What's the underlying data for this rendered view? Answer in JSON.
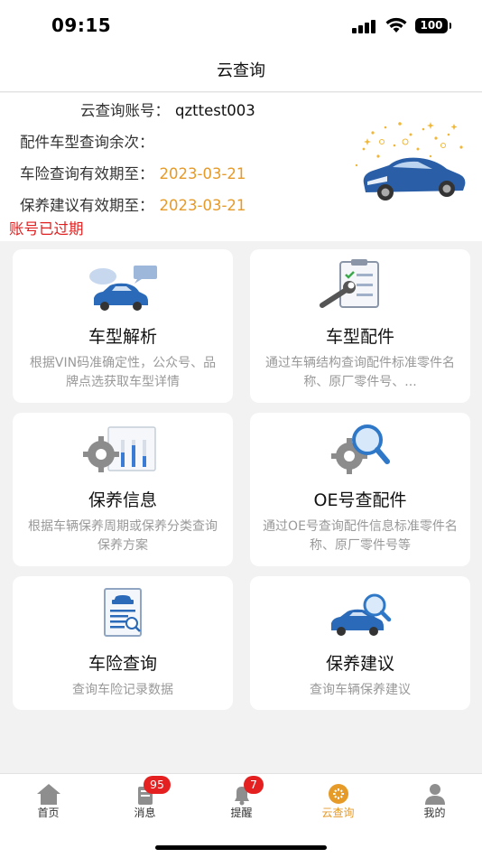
{
  "status_bar": {
    "time": "09:15",
    "battery": "100"
  },
  "nav": {
    "title": "云查询"
  },
  "account": {
    "rows": [
      {
        "label": "云查询账号：",
        "value": "qzttest003"
      },
      {
        "label": "配件车型查询余次：",
        "value": ""
      },
      {
        "label": "车险查询有效期至：",
        "value": "2023-03-21"
      },
      {
        "label": "保养建议有效期至：",
        "value": "2023-03-21"
      }
    ],
    "expired_notice": "账号已过期"
  },
  "cards": [
    {
      "title": "车型解析",
      "desc": "根据VIN码准确定性，公众号、品牌点选获取车型详情",
      "icon": "car-chat-icon"
    },
    {
      "title": "车型配件",
      "desc": "通过车辆结构查询配件标准零件名称、原厂零件号、...",
      "icon": "wrench-checklist-icon"
    },
    {
      "title": "保养信息",
      "desc": "根据车辆保养周期或保养分类查询保养方案",
      "icon": "gear-chart-icon"
    },
    {
      "title": "OE号查配件",
      "desc": "通过OE号查询配件信息标准零件名称、原厂零件号等",
      "icon": "gear-magnifier-icon"
    },
    {
      "title": "车险查询",
      "desc": "查询车险记录数据",
      "icon": "insurance-document-icon"
    },
    {
      "title": "保养建议",
      "desc": "查询车辆保养建议",
      "icon": "car-magnifier-icon"
    }
  ],
  "tabs": [
    {
      "label": "首页",
      "icon": "home-icon",
      "badge": ""
    },
    {
      "label": "消息",
      "icon": "message-icon",
      "badge": "95"
    },
    {
      "label": "提醒",
      "icon": "bell-icon",
      "badge": "7"
    },
    {
      "label": "云查询",
      "icon": "cloud-query-icon",
      "badge": ""
    },
    {
      "label": "我的",
      "icon": "user-icon",
      "badge": ""
    }
  ],
  "colors": {
    "accent": "#e69a27",
    "alert": "#e02020",
    "badge": "#e42020",
    "car_blue": "#2a5fa8"
  }
}
